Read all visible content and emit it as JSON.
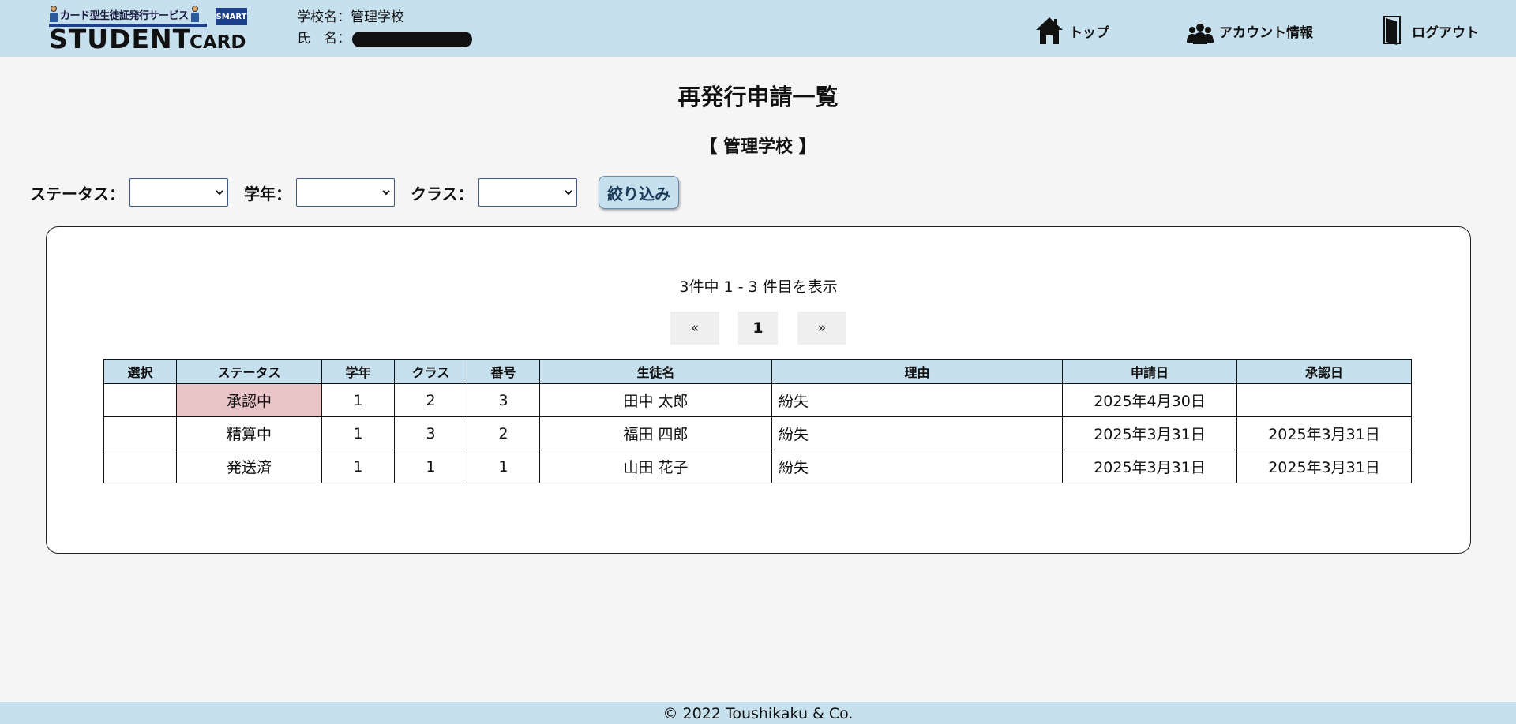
{
  "header": {
    "logo": {
      "service_name": "カード型生徒証発行サービス",
      "smart": "SMART",
      "student": "STUDENT",
      "card": "CARD"
    },
    "school_label": "学校名：",
    "school_name": "管理学校",
    "name_label": "氏　名：",
    "nav": [
      {
        "label": "トップ",
        "icon": "home-icon"
      },
      {
        "label": "アカウント情報",
        "icon": "users-icon"
      },
      {
        "label": "ログアウト",
        "icon": "door-icon"
      }
    ]
  },
  "page": {
    "title": "再発行申請一覧",
    "school_heading": "【 管理学校 】"
  },
  "filters": {
    "status_label": "ステータス：",
    "status_value": "",
    "grade_label": "学年：",
    "grade_value": "",
    "class_label": "クラス：",
    "class_value": "",
    "submit_label": "絞り込み"
  },
  "results": {
    "summary": "3件中 1 - 3 件目を表示",
    "pager": {
      "prev": "«",
      "current": "1",
      "next": "»"
    }
  },
  "table": {
    "columns": [
      "選択",
      "ステータス",
      "学年",
      "クラス",
      "番号",
      "生徒名",
      "理由",
      "申請日",
      "承認日"
    ],
    "rows": [
      {
        "select": "",
        "status": "承認中",
        "grade": "1",
        "class": "2",
        "number": "3",
        "name": "田中 太郎",
        "reason": "紛失",
        "applied": "2025年4月30日",
        "approved": ""
      },
      {
        "select": "",
        "status": "精算中",
        "grade": "1",
        "class": "3",
        "number": "2",
        "name": "福田 四郎",
        "reason": "紛失",
        "applied": "2025年3月31日",
        "approved": "2025年3月31日"
      },
      {
        "select": "",
        "status": "発送済",
        "grade": "1",
        "class": "1",
        "number": "1",
        "name": "山田 花子",
        "reason": "紛失",
        "applied": "2025年3月31日",
        "approved": "2025年3月31日"
      }
    ]
  },
  "colors": {
    "header_bg": "#c6e0ee",
    "page_bg": "#f5f5f5",
    "pending_status_bg": "#e8c4c6",
    "logo_blue": "#1e3f8a"
  },
  "footer": {
    "copyright": "© 2022 Toushikaku & Co."
  }
}
